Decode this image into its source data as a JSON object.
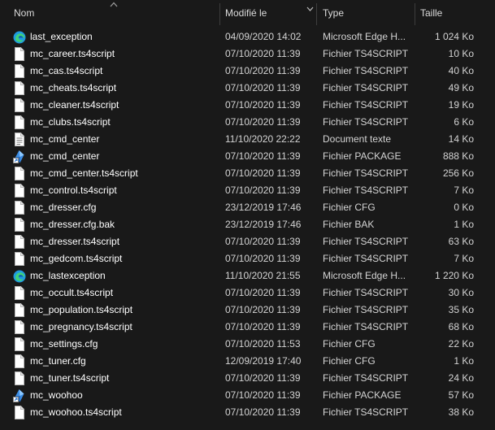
{
  "columns": {
    "name": "Nom",
    "date": "Modifié le",
    "type": "Type",
    "size": "Taille"
  },
  "files": [
    {
      "name": "last_exception",
      "date": "04/09/2020 14:02",
      "type": "Microsoft Edge H...",
      "size": "1 024 Ko",
      "icon": "edge-icon"
    },
    {
      "name": "mc_career.ts4script",
      "date": "07/10/2020 11:39",
      "type": "Fichier TS4SCRIPT",
      "size": "10 Ko",
      "icon": "file-icon"
    },
    {
      "name": "mc_cas.ts4script",
      "date": "07/10/2020 11:39",
      "type": "Fichier TS4SCRIPT",
      "size": "40 Ko",
      "icon": "file-icon"
    },
    {
      "name": "mc_cheats.ts4script",
      "date": "07/10/2020 11:39",
      "type": "Fichier TS4SCRIPT",
      "size": "49 Ko",
      "icon": "file-icon"
    },
    {
      "name": "mc_cleaner.ts4script",
      "date": "07/10/2020 11:39",
      "type": "Fichier TS4SCRIPT",
      "size": "19 Ko",
      "icon": "file-icon"
    },
    {
      "name": "mc_clubs.ts4script",
      "date": "07/10/2020 11:39",
      "type": "Fichier TS4SCRIPT",
      "size": "6 Ko",
      "icon": "file-icon"
    },
    {
      "name": "mc_cmd_center",
      "date": "11/10/2020 22:22",
      "type": "Document texte",
      "size": "14 Ko",
      "icon": "text-document-icon"
    },
    {
      "name": "mc_cmd_center",
      "date": "07/10/2020 11:39",
      "type": "Fichier PACKAGE",
      "size": "888 Ko",
      "icon": "sims-package-icon"
    },
    {
      "name": "mc_cmd_center.ts4script",
      "date": "07/10/2020 11:39",
      "type": "Fichier TS4SCRIPT",
      "size": "256 Ko",
      "icon": "file-icon"
    },
    {
      "name": "mc_control.ts4script",
      "date": "07/10/2020 11:39",
      "type": "Fichier TS4SCRIPT",
      "size": "7 Ko",
      "icon": "file-icon"
    },
    {
      "name": "mc_dresser.cfg",
      "date": "23/12/2019 17:46",
      "type": "Fichier CFG",
      "size": "0 Ko",
      "icon": "file-icon"
    },
    {
      "name": "mc_dresser.cfg.bak",
      "date": "23/12/2019 17:46",
      "type": "Fichier BAK",
      "size": "1 Ko",
      "icon": "file-icon"
    },
    {
      "name": "mc_dresser.ts4script",
      "date": "07/10/2020 11:39",
      "type": "Fichier TS4SCRIPT",
      "size": "63 Ko",
      "icon": "file-icon"
    },
    {
      "name": "mc_gedcom.ts4script",
      "date": "07/10/2020 11:39",
      "type": "Fichier TS4SCRIPT",
      "size": "7 Ko",
      "icon": "file-icon"
    },
    {
      "name": "mc_lastexception",
      "date": "11/10/2020 21:55",
      "type": "Microsoft Edge H...",
      "size": "1 220 Ko",
      "icon": "edge-icon"
    },
    {
      "name": "mc_occult.ts4script",
      "date": "07/10/2020 11:39",
      "type": "Fichier TS4SCRIPT",
      "size": "30 Ko",
      "icon": "file-icon"
    },
    {
      "name": "mc_population.ts4script",
      "date": "07/10/2020 11:39",
      "type": "Fichier TS4SCRIPT",
      "size": "35 Ko",
      "icon": "file-icon"
    },
    {
      "name": "mc_pregnancy.ts4script",
      "date": "07/10/2020 11:39",
      "type": "Fichier TS4SCRIPT",
      "size": "68 Ko",
      "icon": "file-icon"
    },
    {
      "name": "mc_settings.cfg",
      "date": "07/10/2020 11:53",
      "type": "Fichier CFG",
      "size": "22 Ko",
      "icon": "file-icon"
    },
    {
      "name": "mc_tuner.cfg",
      "date": "12/09/2019 17:40",
      "type": "Fichier CFG",
      "size": "1 Ko",
      "icon": "file-icon"
    },
    {
      "name": "mc_tuner.ts4script",
      "date": "07/10/2020 11:39",
      "type": "Fichier TS4SCRIPT",
      "size": "24 Ko",
      "icon": "file-icon"
    },
    {
      "name": "mc_woohoo",
      "date": "07/10/2020 11:39",
      "type": "Fichier PACKAGE",
      "size": "57 Ko",
      "icon": "sims-package-icon"
    },
    {
      "name": "mc_woohoo.ts4script",
      "date": "07/10/2020 11:39",
      "type": "Fichier TS4SCRIPT",
      "size": "38 Ko",
      "icon": "file-icon"
    }
  ],
  "colors": {
    "background": "#191919",
    "text": "#ffffff",
    "secondary_text": "#d4d4d4",
    "separator": "#3d3d3d"
  }
}
